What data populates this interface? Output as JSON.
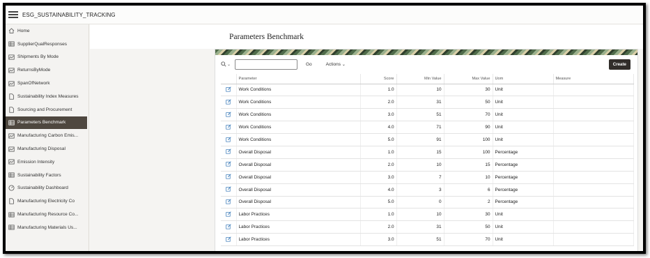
{
  "app": {
    "title": "ESG_SUSTAINABILITY_TRACKING"
  },
  "sidebar": {
    "items": [
      {
        "label": "Home",
        "icon": "home-icon"
      },
      {
        "label": "SupplierQualResponses",
        "icon": "table-icon"
      },
      {
        "label": "Shipments By Mode",
        "icon": "chart-icon"
      },
      {
        "label": "ReturnsByMode",
        "icon": "chart-icon"
      },
      {
        "label": "SpanOfNetwork",
        "icon": "chart-icon"
      },
      {
        "label": "Sustainability Index Measures",
        "icon": "page-icon"
      },
      {
        "label": "Sourcing and Procurement",
        "icon": "page-icon"
      },
      {
        "label": "Parameters Benchmark",
        "icon": "table-icon",
        "active": true
      },
      {
        "label": "Manufacturing Carbon Emis...",
        "icon": "chart-icon"
      },
      {
        "label": "Manufacturing Disposal",
        "icon": "chart-icon"
      },
      {
        "label": "Emission Intensity",
        "icon": "chart-icon"
      },
      {
        "label": "Sustainability Factors",
        "icon": "table-icon"
      },
      {
        "label": "Sustainability Dashboard",
        "icon": "dashboard-icon"
      },
      {
        "label": "Manufacturing Electricity Co",
        "icon": "page-icon"
      },
      {
        "label": "Manufacturing Resource Co...",
        "icon": "table-icon"
      },
      {
        "label": "Manufacturing Materials Us...",
        "icon": "table-icon"
      }
    ]
  },
  "page": {
    "title": "Parameters Benchmark"
  },
  "toolbar": {
    "search_value": "",
    "search_selector": "Q",
    "go_label": "Go",
    "actions_label": "Actions",
    "create_label": "Create"
  },
  "table": {
    "columns": [
      "",
      "Parameter",
      "Score",
      "Min Value",
      "Max Value",
      "Uom",
      "Measure"
    ],
    "rows": [
      [
        "Work Conditions",
        "1.0",
        "10",
        "30",
        "Unit",
        ""
      ],
      [
        "Work Conditions",
        "2.0",
        "31",
        "50",
        "Unit",
        ""
      ],
      [
        "Work Conditions",
        "3.0",
        "51",
        "70",
        "Unit",
        ""
      ],
      [
        "Work Conditions",
        "4.0",
        "71",
        "90",
        "Unit",
        ""
      ],
      [
        "Work Conditions",
        "5.0",
        "91",
        "100",
        "Unit",
        ""
      ],
      [
        "Overall Disposal",
        "1.0",
        "15",
        "100",
        "Percentage",
        ""
      ],
      [
        "Overall Disposal",
        "2.0",
        "10",
        "15",
        "Percentage",
        ""
      ],
      [
        "Overall Disposal",
        "3.0",
        "7",
        "10",
        "Percentage",
        ""
      ],
      [
        "Overall Disposal",
        "4.0",
        "3",
        "6",
        "Percentage",
        ""
      ],
      [
        "Overall Disposal",
        "5.0",
        "0",
        "2",
        "Percentage",
        ""
      ],
      [
        "Labor Practices",
        "1.0",
        "10",
        "30",
        "Unit",
        ""
      ],
      [
        "Labor Practices",
        "2.0",
        "31",
        "50",
        "Unit",
        ""
      ],
      [
        "Labor Practices",
        "3.0",
        "51",
        "70",
        "Unit",
        ""
      ]
    ]
  },
  "colors": {
    "active_nav_bg": "#4e473f",
    "create_button_bg": "#312d2a",
    "edit_icon": "#3a7ab8"
  }
}
